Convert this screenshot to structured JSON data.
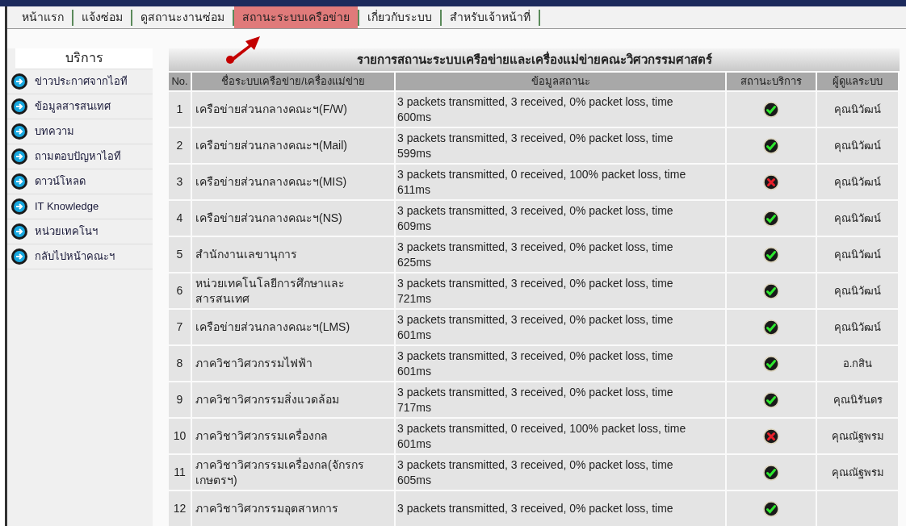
{
  "nav": [
    {
      "label": "หน้าแรก",
      "selected": false
    },
    {
      "label": "แจ้งซ่อม",
      "selected": false
    },
    {
      "label": "ดูสถานะงานซ่อม",
      "selected": false
    },
    {
      "label": "สถานะระบบเครือข่าย",
      "selected": true
    },
    {
      "label": "เกี่ยวกับระบบ",
      "selected": false
    },
    {
      "label": "สำหรับเจ้าหน้าที่",
      "selected": false
    }
  ],
  "sidebar": {
    "title": "บริการ",
    "items": [
      "ข่าวประกาศจากไอที",
      "ข้อมูลสารสนเทศ",
      "บทความ",
      "ถามตอบปัญหาไอที",
      "ดาวน์โหลด",
      "IT Knowledge",
      "หน่วยเทคโนฯ",
      "กลับไปหน้าคณะฯ"
    ]
  },
  "table": {
    "title": "รายการสถานะระบบเครือข่ายและเครื่องแม่ข่ายคณะวิศวกรรมศาสตร์",
    "columns": [
      "No.",
      "ชื่อระบบเครือข่าย/เครื่องแม่ข่าย",
      "ข้อมูลสถานะ",
      "สถานะบริการ",
      "ผู้ดูแลระบบ"
    ],
    "rows": [
      {
        "no": "1",
        "name": "เครือข่ายส่วนกลางคณะฯ(F/W)",
        "info": "3 packets transmitted, 3 received, 0% packet loss, time 600ms",
        "ok": true,
        "admin": "คุณนิวัฒน์"
      },
      {
        "no": "2",
        "name": "เครือข่ายส่วนกลางคณะฯ(Mail)",
        "info": "3 packets transmitted, 3 received, 0% packet loss, time 599ms",
        "ok": true,
        "admin": "คุณนิวัฒน์"
      },
      {
        "no": "3",
        "name": "เครือข่ายส่วนกลางคณะฯ(MIS)",
        "info": "3 packets transmitted, 0 received, 100% packet loss, time 611ms",
        "ok": false,
        "admin": "คุณนิวัฒน์"
      },
      {
        "no": "4",
        "name": "เครือข่ายส่วนกลางคณะฯ(NS)",
        "info": "3 packets transmitted, 3 received, 0% packet loss, time 609ms",
        "ok": true,
        "admin": "คุณนิวัฒน์"
      },
      {
        "no": "5",
        "name": "สำนักงานเลขานุการ",
        "info": "3 packets transmitted, 3 received, 0% packet loss, time 625ms",
        "ok": true,
        "admin": "คุณนิวัฒน์"
      },
      {
        "no": "6",
        "name": "หน่วยเทคโนโลยีการศึกษาและสารสนเทศ",
        "info": "3 packets transmitted, 3 received, 0% packet loss, time 721ms",
        "ok": true,
        "admin": "คุณนิวัฒน์"
      },
      {
        "no": "7",
        "name": "เครือข่ายส่วนกลางคณะฯ(LMS)",
        "info": "3 packets transmitted, 3 received, 0% packet loss, time 601ms",
        "ok": true,
        "admin": "คุณนิวัฒน์"
      },
      {
        "no": "8",
        "name": "ภาควิชาวิศวกรรมไฟฟ้า",
        "info": "3 packets transmitted, 3 received, 0% packet loss, time 601ms",
        "ok": true,
        "admin": "อ.กสิน"
      },
      {
        "no": "9",
        "name": "ภาควิชาวิศวกรรมสิ่งแวดล้อม",
        "info": "3 packets transmitted, 3 received, 0% packet loss, time 717ms",
        "ok": true,
        "admin": "คุณนิรันดร"
      },
      {
        "no": "10",
        "name": "ภาควิชาวิศวกรรมเครื่องกล",
        "info": "3 packets transmitted, 0 received, 100% packet loss, time 601ms",
        "ok": false,
        "admin": "คุณณัฐพรม"
      },
      {
        "no": "11",
        "name": "ภาควิชาวิศวกรรมเครื่องกล(จักรกรเกษตรฯ)",
        "info": "3 packets transmitted, 3 received, 0% packet loss, time 605ms",
        "ok": true,
        "admin": "คุณณัฐพรม"
      },
      {
        "no": "12",
        "name": "ภาควิชาวิศวกรรมอุตสาหการ",
        "info": "3 packets transmitted, 3 received, 0% packet loss, time",
        "ok": true
      }
    ]
  }
}
